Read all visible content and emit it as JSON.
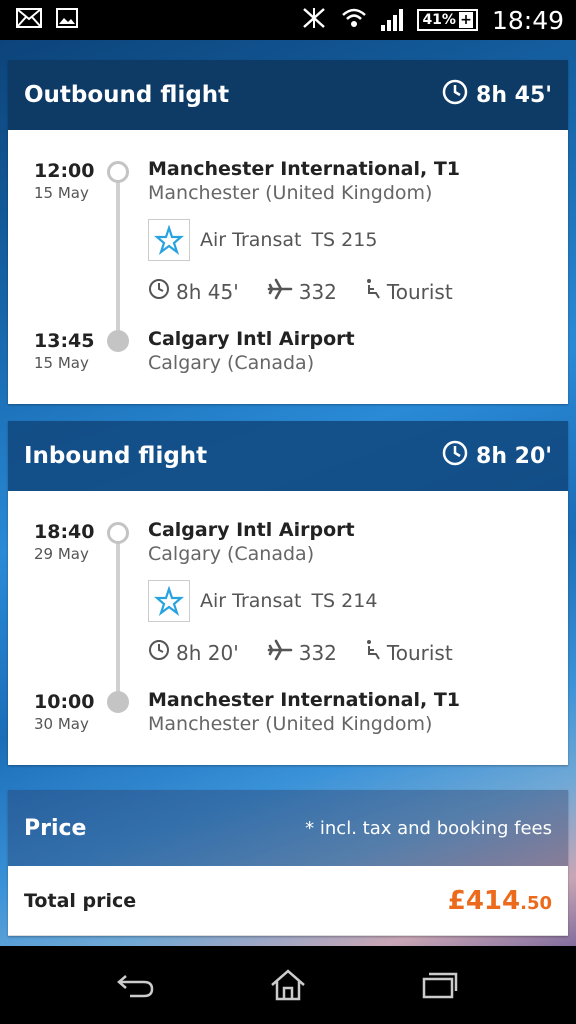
{
  "status_bar": {
    "battery": "41%",
    "time": "18:49",
    "icons": [
      "mail-icon",
      "image-icon",
      "mute-icon",
      "wifi-icon",
      "signal-icon",
      "battery-icon"
    ]
  },
  "outbound": {
    "title": "Outbound flight",
    "duration": "8h 45'",
    "departure": {
      "time": "12:00",
      "date": "15 May",
      "airport": "Manchester International, T1",
      "city": "Manchester (United Kingdom)"
    },
    "airline": "Air Transat",
    "flight_number": "TS 215",
    "flight_duration": "8h 45'",
    "aircraft": "332",
    "cabin": "Tourist",
    "arrival": {
      "time": "13:45",
      "date": "15 May",
      "airport": "Calgary Intl Airport",
      "city": "Calgary (Canada)"
    }
  },
  "inbound": {
    "title": "Inbound flight",
    "duration": "8h 20'",
    "departure": {
      "time": "18:40",
      "date": "29 May",
      "airport": "Calgary Intl Airport",
      "city": "Calgary (Canada)"
    },
    "airline": "Air Transat",
    "flight_number": "TS 214",
    "flight_duration": "8h 20'",
    "aircraft": "332",
    "cabin": "Tourist",
    "arrival": {
      "time": "10:00",
      "date": "30 May",
      "airport": "Manchester International, T1",
      "city": "Manchester (United Kingdom)"
    }
  },
  "price": {
    "title": "Price",
    "note": "* incl. tax and booking fees",
    "total_label": "Total price",
    "total_main": "£414",
    "total_decimal": ".50"
  },
  "colors": {
    "header_dark": "#0e3a66",
    "price_orange": "#ec6a1c",
    "timeline_grey": "#c4c4c4"
  }
}
